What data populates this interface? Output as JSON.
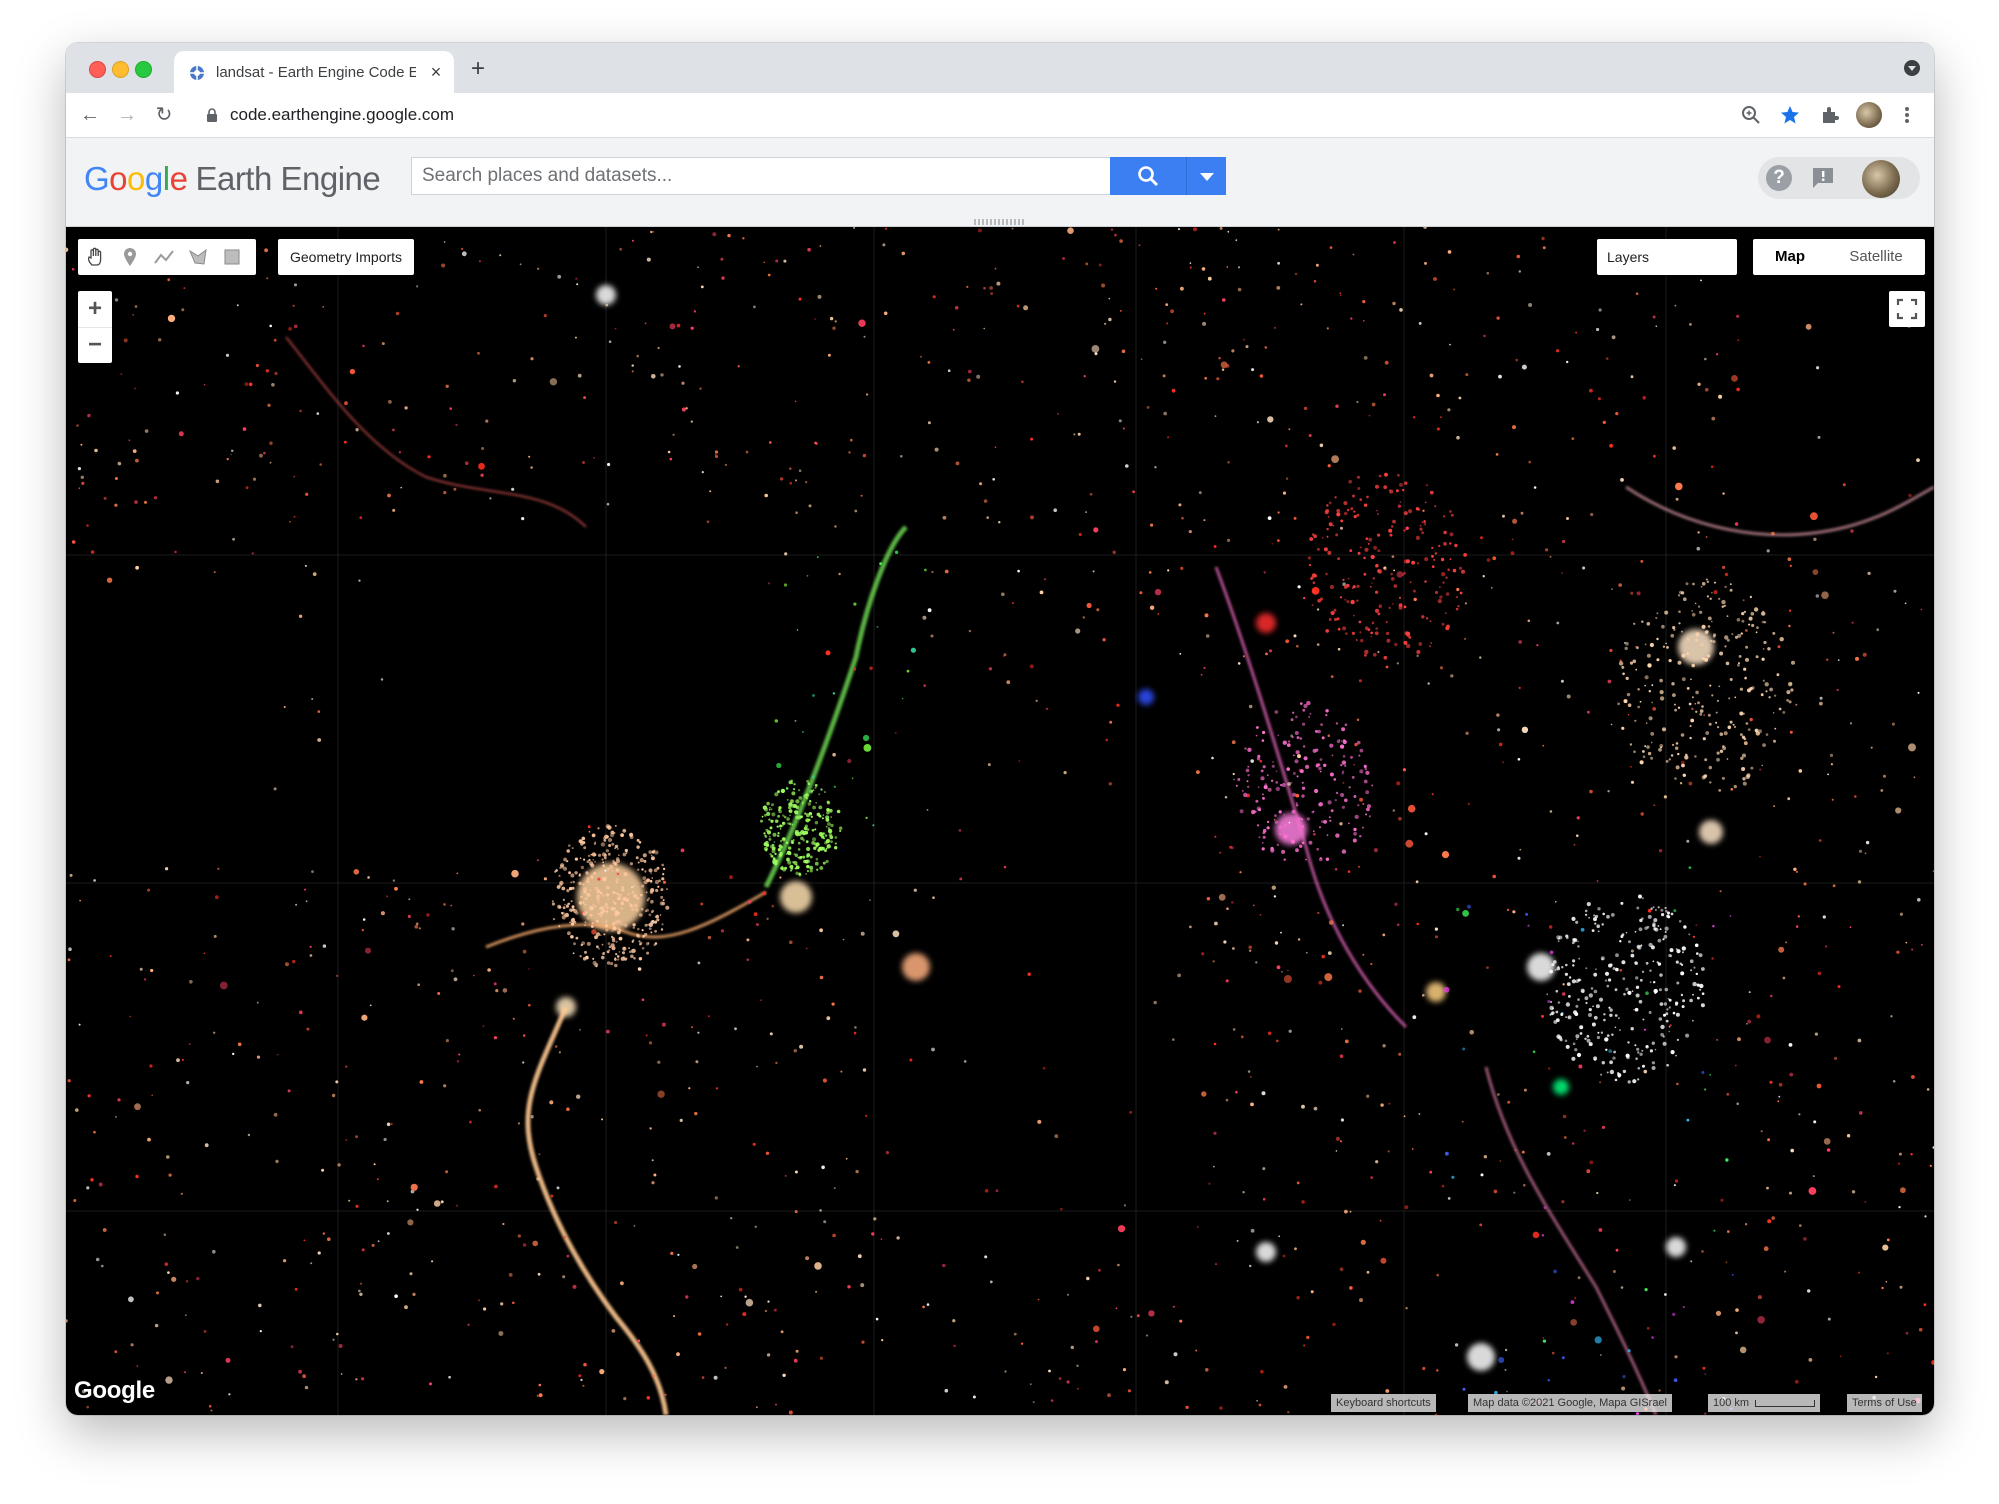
{
  "browser": {
    "tab_title": "landsat - Earth Engine Code Ed",
    "tab_close": "×",
    "new_tab": "+",
    "back": "←",
    "forward": "→",
    "reload": "↻",
    "url": "code.earthengine.google.com"
  },
  "header": {
    "logo_google": [
      "G",
      "o",
      "o",
      "g",
      "l",
      "e"
    ],
    "logo_product": "Earth Engine",
    "search_placeholder": "Search places and datasets...",
    "help": "?"
  },
  "map": {
    "geometry_imports": "Geometry Imports",
    "layers": "Layers",
    "map_type_map": "Map",
    "map_type_satellite": "Satellite",
    "zoom_in": "+",
    "zoom_out": "−",
    "watermark": "Google",
    "keyboard_shortcuts": "Keyboard shortcuts",
    "map_data": "Map data ©2021 Google, Mapa GISrael",
    "scale": "100 km",
    "terms": "Terms of Use"
  },
  "colors": {
    "accent_blue": "#3c7ff2",
    "map_background": "#000000",
    "chrome_tabstrip": "#dee1e6"
  },
  "icons": {
    "draw_tools": [
      "hand-icon",
      "marker-icon",
      "line-icon",
      "polygon-icon",
      "rectangle-icon"
    ],
    "toolbar": [
      "zoom-icon",
      "star-icon",
      "extensions-icon",
      "profile-icon",
      "more-icon"
    ]
  }
}
